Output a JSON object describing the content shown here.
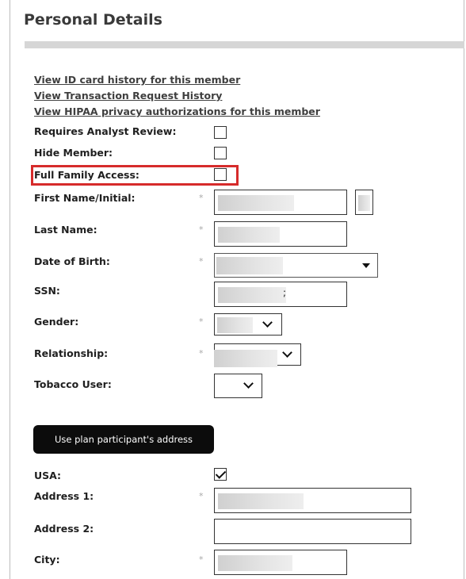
{
  "section": {
    "title": "Personal Details"
  },
  "links": [
    "View ID card history for this member",
    "View Transaction Request History",
    "View HIPAA privacy authorizations for this member"
  ],
  "fields": {
    "requires_analyst_review": {
      "label": "Requires Analyst Review:",
      "checked": false
    },
    "hide_member": {
      "label": "Hide Member:",
      "checked": false
    },
    "full_family_access": {
      "label": "Full Family Access:",
      "checked": false
    },
    "first_name": {
      "label": "First Name/Initial:",
      "required": true
    },
    "last_name": {
      "label": "Last Name:",
      "required": true
    },
    "date_of_birth": {
      "label": "Date of Birth:",
      "required": true
    },
    "ssn": {
      "label": "SSN:",
      "value_suffix": ";"
    },
    "gender": {
      "label": "Gender:",
      "required": true
    },
    "relationship": {
      "label": "Relationship:",
      "required": true
    },
    "tobacco_user": {
      "label": "Tobacco User:"
    },
    "usa": {
      "label": "USA:",
      "checked": true
    },
    "address1": {
      "label": "Address 1:",
      "required": true
    },
    "address2": {
      "label": "Address 2:"
    },
    "city": {
      "label": "City:",
      "required": true
    }
  },
  "buttons": {
    "use_plan_address": "Use plan participant's address"
  },
  "required_marker": "*",
  "colors": {
    "highlight": "#d62b2b",
    "button_bg": "#0c0c0c"
  }
}
